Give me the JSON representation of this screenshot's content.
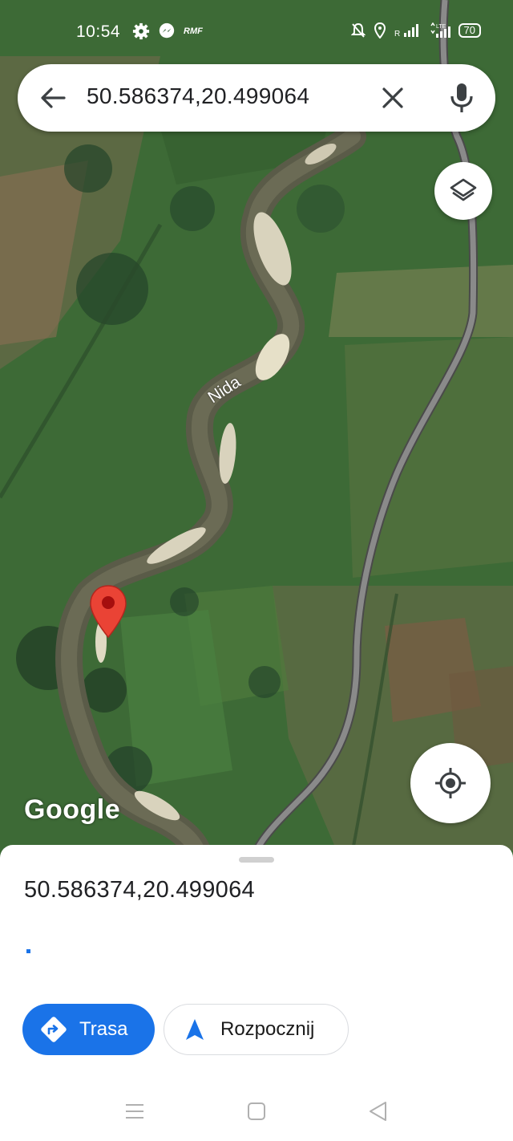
{
  "status_bar": {
    "time": "10:54",
    "carrier_label": "RMF",
    "battery": "70",
    "icons": [
      "settings-icon",
      "messenger-icon",
      "rmf-icon",
      "mute-bell-icon",
      "location-icon",
      "signal-icon",
      "lte-icon",
      "battery-icon"
    ]
  },
  "search": {
    "query": "50.586374,20.499064",
    "icons": [
      "back-arrow-icon",
      "clear-icon",
      "mic-icon"
    ]
  },
  "map": {
    "river_label": "Nida",
    "attribution": "Google",
    "marker_color": "#ea4335",
    "road_color": "#8a8a8a"
  },
  "sheet": {
    "title": "50.586374,20.499064",
    "route_button": "Trasa",
    "start_button": "Rozpocznij",
    "accent": "#1a73e8"
  },
  "nav_bar": {
    "icons": [
      "menu-icon",
      "home-icon",
      "back-icon"
    ]
  }
}
